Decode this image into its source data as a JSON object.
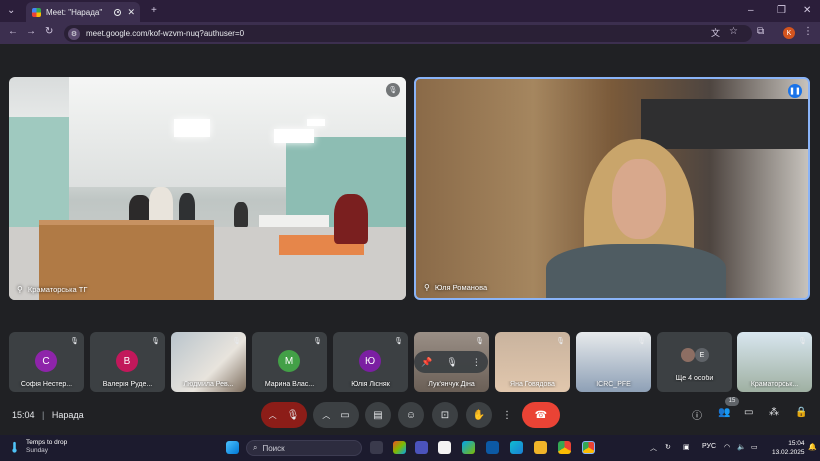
{
  "browser": {
    "tab_title": "Meet: \"Нарада\"",
    "url": "meet.google.com/kof-wzvm-nuq?authuser=0",
    "profile_initial": "K"
  },
  "main_tiles": [
    {
      "name": "Краматорська ТГ"
    },
    {
      "name": "Юля Романова"
    }
  ],
  "participants": [
    {
      "initial": "С",
      "color": "#8e24aa",
      "name": "Софія Нестер..."
    },
    {
      "initial": "В",
      "color": "#c2185b",
      "name": "Валерія Руде..."
    },
    {
      "initial": "",
      "color": "",
      "name": "Людмила Рев..."
    },
    {
      "initial": "М",
      "color": "#43a047",
      "name": "Марина Влас..."
    },
    {
      "initial": "Ю",
      "color": "#7b1fa2",
      "name": "Юлія Лісняк"
    },
    {
      "initial": "",
      "color": "",
      "name": "Лук'янчук Діна"
    },
    {
      "initial": "",
      "color": "",
      "name": "Яна Говядова"
    },
    {
      "initial": "",
      "color": "",
      "name": "ICRC_PFE"
    },
    {
      "initial": "E",
      "color": "#5f6368",
      "name": "Ще 4 особи"
    },
    {
      "initial": "",
      "color": "",
      "name": "Краматорськ..."
    }
  ],
  "controls": {
    "time": "15:04",
    "meeting_name": "Нарада",
    "people_count": "15"
  },
  "taskbar": {
    "weather_line1": "Temps to drop",
    "weather_line2": "Sunday",
    "search_placeholder": "Поиск",
    "lang": "РУС",
    "clock_time": "15:04",
    "clock_date": "13.02.2025"
  },
  "colors": {
    "accent": "#8ab4f8",
    "hangup": "#ea4335",
    "speaking": "#1a73e8"
  }
}
